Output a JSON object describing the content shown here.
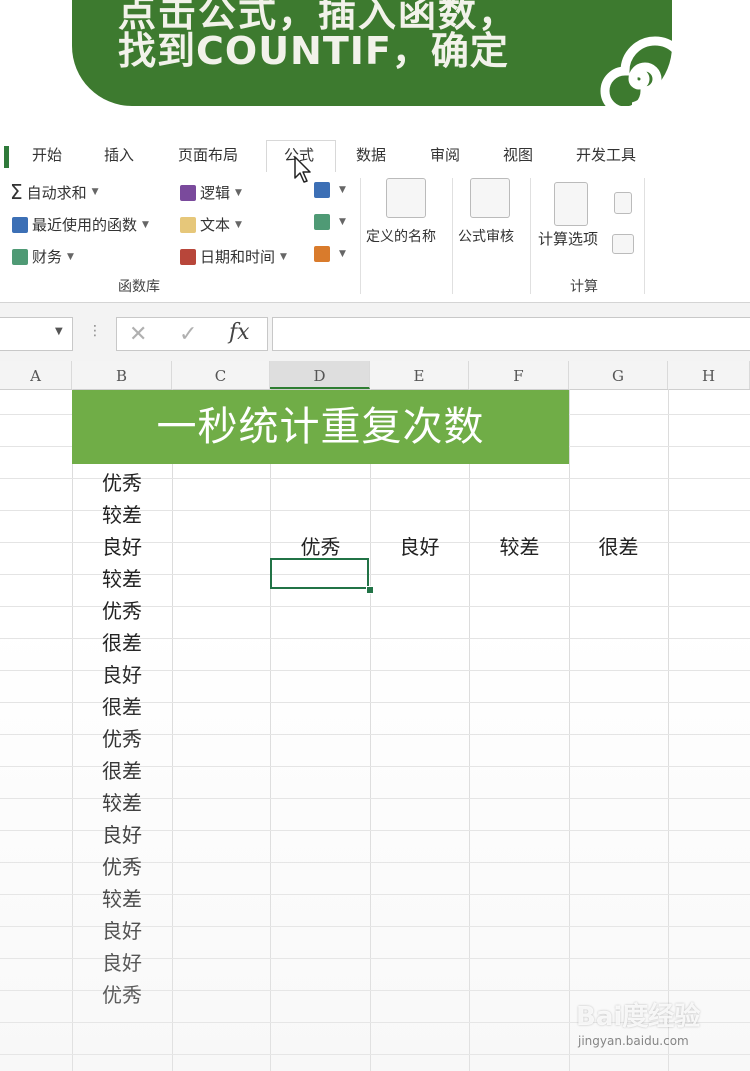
{
  "banner": {
    "line1": "点击公式，插入函数，",
    "line2": "找到COUNTIF，确定"
  },
  "ribbon": {
    "tabs": [
      "开始",
      "插入",
      "页面布局",
      "公式",
      "数据",
      "审阅",
      "视图",
      "开发工具"
    ],
    "active_tab": "公式",
    "function_library": {
      "autosum": "自动求和",
      "recent": "最近使用的函数",
      "financial": "财务",
      "logical": "逻辑",
      "text": "文本",
      "datetime": "日期和时间",
      "group_label": "函数库"
    },
    "defined_names": "定义的名称",
    "formula_auditing": "公式审核",
    "calc_options": "计算选项",
    "calc_group_label": "计算"
  },
  "formula_bar": {
    "fx": "fx",
    "name_box": "",
    "formula": ""
  },
  "sheet": {
    "columns": [
      "A",
      "B",
      "C",
      "D",
      "E",
      "F",
      "G",
      "H"
    ],
    "selected_column": "D",
    "title": "一秒统计重复次数",
    "col_b_values": [
      "优秀",
      "较差",
      "良好",
      "较差",
      "优秀",
      "很差",
      "良好",
      "很差",
      "优秀",
      "很差",
      "较差",
      "良好",
      "优秀",
      "较差",
      "良好",
      "良好",
      "优秀"
    ],
    "headers": [
      "优秀",
      "良好",
      "较差",
      "很差"
    ]
  },
  "watermark": {
    "text": "Bai度经验",
    "url": "jingyan.baidu.com"
  },
  "colors": {
    "banner_green": "#3d7a2f",
    "title_green": "#70ad47",
    "selection_green": "#217346"
  }
}
